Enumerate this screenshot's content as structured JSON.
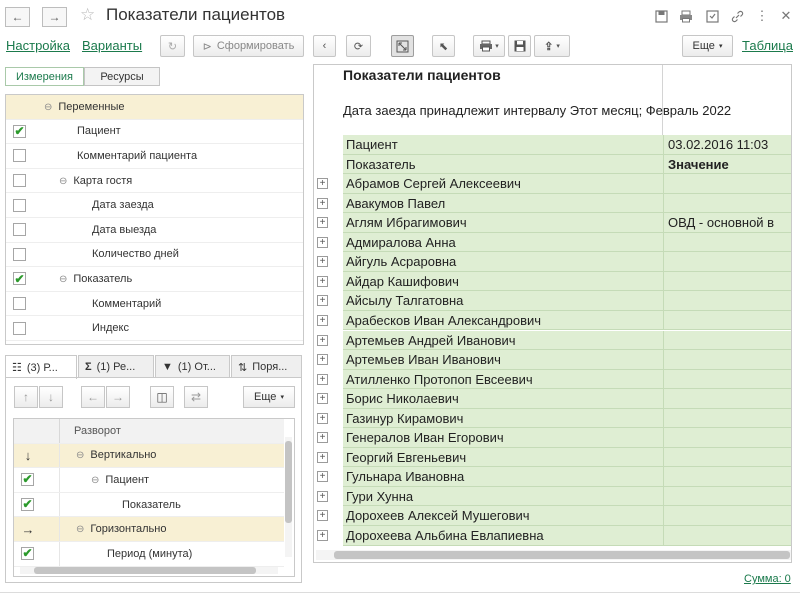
{
  "window": {
    "title": "Показатели пациентов",
    "icons": [
      "back-arrow-icon",
      "forward-arrow-icon",
      "star-icon",
      "save-icon",
      "print-icon",
      "compare-icon",
      "link-icon",
      "more-icon",
      "close-icon"
    ]
  },
  "toolbar": {
    "settings_link": "Настройка",
    "variants_link": "Варианты",
    "generate_label": "Сформировать",
    "more_label": "Еще",
    "table_link": "Таблица"
  },
  "left_panel": {
    "seg_dimensions": "Измерения",
    "seg_resources": "Ресурсы",
    "tree": [
      {
        "label": "Переменные",
        "checked": null,
        "expander": "⊖",
        "indent": 0,
        "selected": true
      },
      {
        "label": "Пациент",
        "checked": true,
        "expander": "",
        "indent": 1,
        "selected": false
      },
      {
        "label": "Комментарий пациента",
        "checked": false,
        "expander": "",
        "indent": 1,
        "selected": false
      },
      {
        "label": "Карта гостя",
        "checked": false,
        "expander": "⊖",
        "indent": 1,
        "selected": false
      },
      {
        "label": "Дата заезда",
        "checked": false,
        "expander": "",
        "indent": 2,
        "selected": false
      },
      {
        "label": "Дата выезда",
        "checked": false,
        "expander": "",
        "indent": 2,
        "selected": false
      },
      {
        "label": "Количество дней",
        "checked": false,
        "expander": "",
        "indent": 2,
        "selected": false
      },
      {
        "label": "Показатель",
        "checked": true,
        "expander": "⊖",
        "indent": 1,
        "selected": false
      },
      {
        "label": "Комментарий",
        "checked": false,
        "expander": "",
        "indent": 2,
        "selected": false
      },
      {
        "label": "Индекс",
        "checked": false,
        "expander": "",
        "indent": 2,
        "selected": false
      }
    ]
  },
  "lower_panel": {
    "tabs": [
      "(3) Р...",
      "(1) Ре...",
      "(1) От...",
      "Поря..."
    ],
    "more_label": "Еще",
    "tree_header": "Разворот",
    "tree": [
      {
        "label": "Вертикально",
        "mark": "↓",
        "expander": "⊖",
        "indent": 0,
        "selected": true
      },
      {
        "label": "Пациент",
        "mark": "✔",
        "expander": "⊖",
        "indent": 1,
        "selected": false
      },
      {
        "label": "Показатель",
        "mark": "✔",
        "expander": "",
        "indent": 2,
        "selected": false
      },
      {
        "label": "Горизонтально",
        "mark": "→",
        "expander": "⊖",
        "indent": 0,
        "selected": true
      },
      {
        "label": "Период (минута)",
        "mark": "✔",
        "expander": "",
        "indent": 1,
        "selected": false
      }
    ]
  },
  "report": {
    "title": "Показатели пациентов",
    "filter": "Дата заезда принадлежит интервалу Этот месяц;  Февраль 2022",
    "header_row1_left": "Пациент",
    "header_row1_right": "03.02.2016 11:03",
    "header_row2_left": "Показатель",
    "header_row2_right": "Значение",
    "rows": [
      {
        "name": "Абрамов Сергей Алексеевич",
        "value": ""
      },
      {
        "name": "Авакумов Павел",
        "value": ""
      },
      {
        "name": "Аглям Ибрагимович",
        "value": "ОВД - основной в"
      },
      {
        "name": "Адмиралова Анна",
        "value": ""
      },
      {
        "name": "Айгуль Асраровна",
        "value": ""
      },
      {
        "name": "Айдар Кашифович",
        "value": ""
      },
      {
        "name": "Айсылу Талгатовна",
        "value": ""
      },
      {
        "name": "Арабесков Иван Александрович",
        "value": ""
      },
      {
        "name": "Артемьев Андрей Иванович",
        "value": ""
      },
      {
        "name": "Артемьев Иван Иванович",
        "value": ""
      },
      {
        "name": "Атилленко Протопоп Евсеевич",
        "value": ""
      },
      {
        "name": "Борис Николаевич",
        "value": ""
      },
      {
        "name": "Газинур Кирамович",
        "value": ""
      },
      {
        "name": "Генералов Иван Егорович",
        "value": ""
      },
      {
        "name": "Георгий Евгеньевич",
        "value": ""
      },
      {
        "name": "Гульнара Ивановна",
        "value": ""
      },
      {
        "name": "Гури Хунна",
        "value": ""
      },
      {
        "name": "Дорохеев Алексей Мушегович",
        "value": ""
      },
      {
        "name": "Дорохеева Альбина Евлапиевна",
        "value": ""
      }
    ]
  },
  "status": {
    "sum": "Сумма: 0"
  }
}
